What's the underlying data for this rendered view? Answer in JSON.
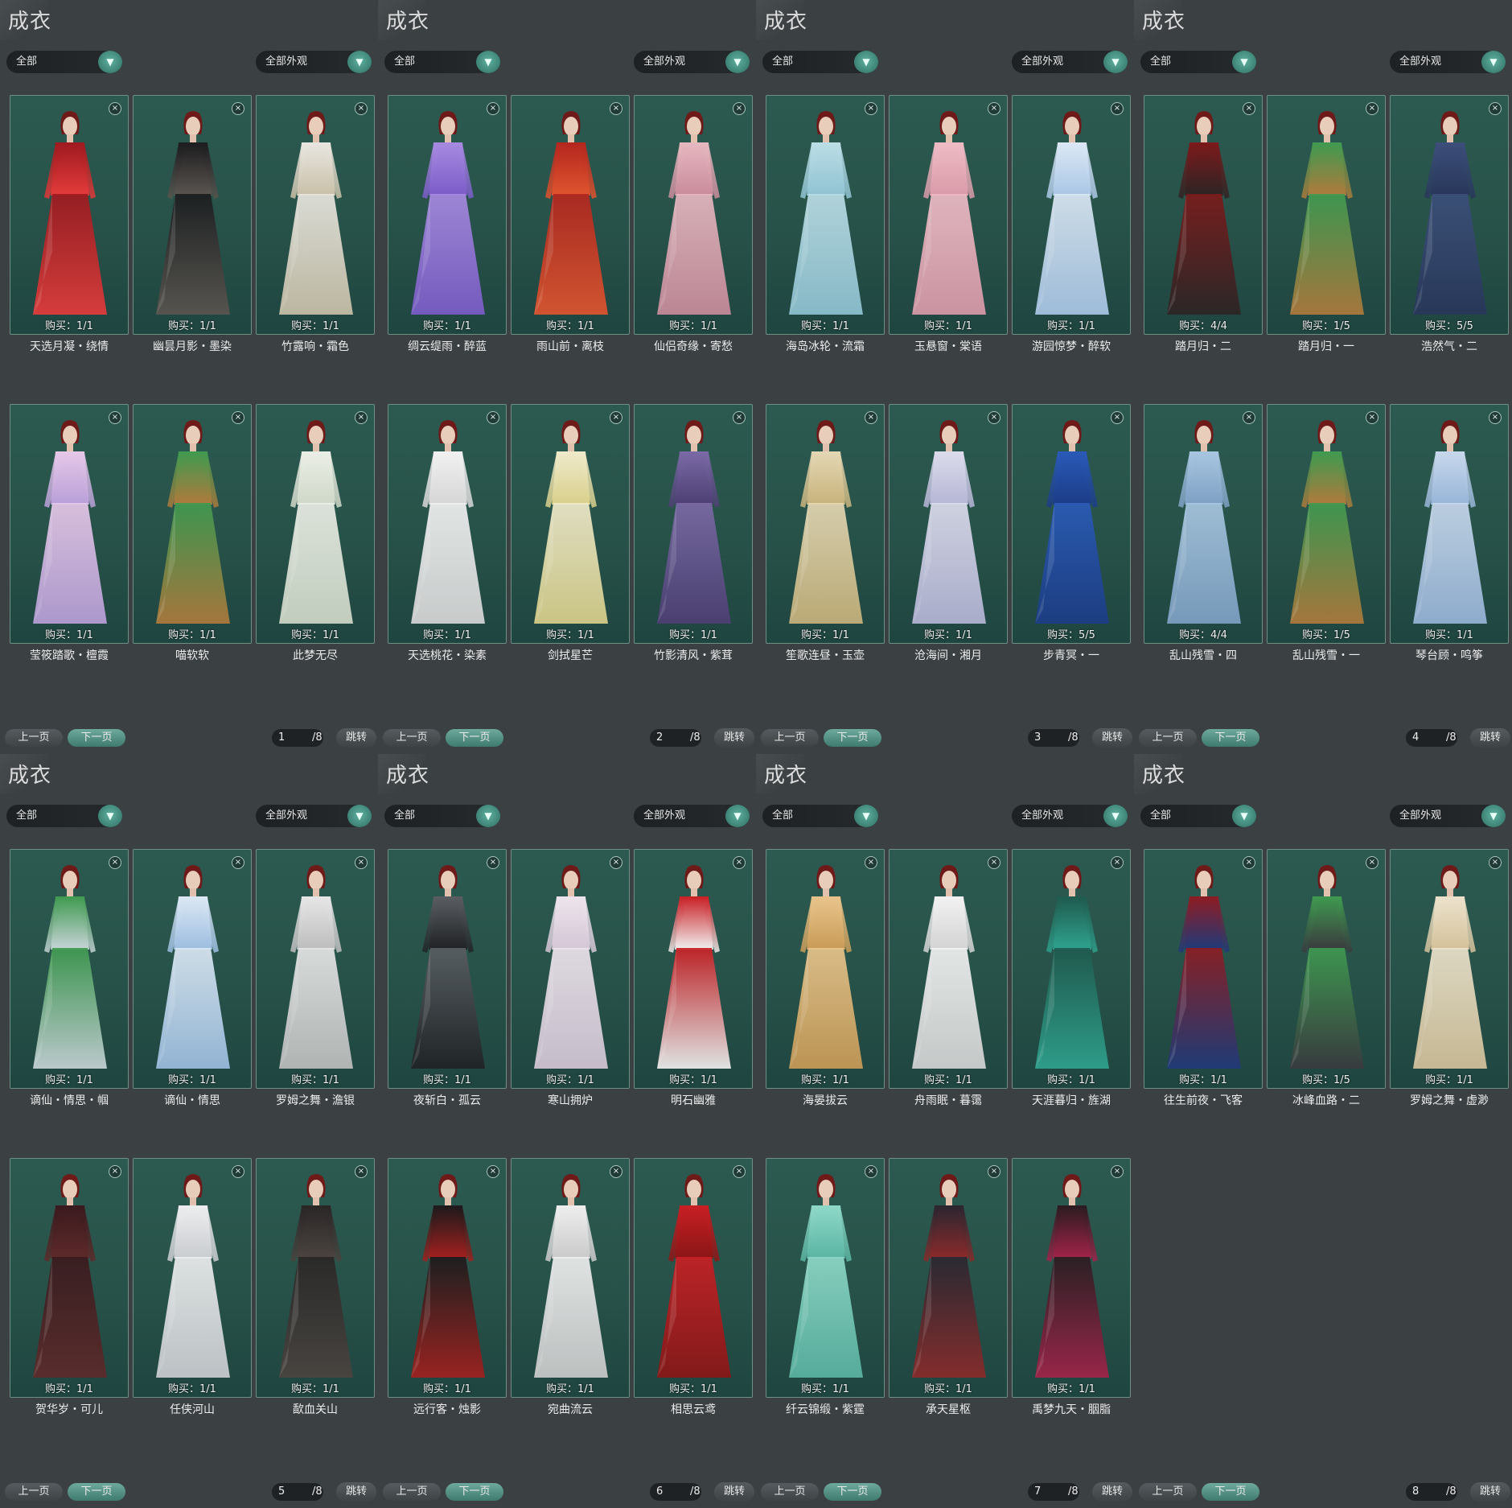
{
  "panels": [
    {
      "title": "成衣",
      "filter_left": "全部",
      "filter_right": "全部外观",
      "prev_label": "上一页",
      "next_label": "下一页",
      "page": "1",
      "total": "/8",
      "jump_label": "跳转",
      "cards": [
        {
          "buy": "购买：1/1",
          "name": "天选月凝・绕情",
          "colors": [
            "#9e1a1f",
            "#e43b3b"
          ]
        },
        {
          "buy": "购买：1/1",
          "name": "幽昙月影・墨染",
          "colors": [
            "#1c1c1e",
            "#5b5550"
          ]
        },
        {
          "buy": "购买：1/1",
          "name": "竹露响・霜色",
          "colors": [
            "#e8e6e0",
            "#c9c0a8"
          ]
        },
        {
          "buy": "购买：1/1",
          "name": "莹筱踏歌・檀霞",
          "colors": [
            "#e6c8e8",
            "#b89fd8"
          ]
        },
        {
          "buy": "购买：1/1",
          "name": "喵软软",
          "colors": [
            "#3f9a50",
            "#b07a3c"
          ]
        },
        {
          "buy": "购买：1/1",
          "name": "此梦无尽",
          "colors": [
            "#ebeee6",
            "#cfd8c8"
          ]
        }
      ]
    },
    {
      "title": "成衣",
      "filter_left": "全部",
      "filter_right": "全部外观",
      "prev_label": "上一页",
      "next_label": "下一页",
      "page": "2",
      "total": "/8",
      "jump_label": "跳转",
      "cards": [
        {
          "buy": "购买：1/1",
          "name": "绸云缇雨・醉蓝",
          "colors": [
            "#a78ae0",
            "#7b5cc9"
          ]
        },
        {
          "buy": "购买：1/1",
          "name": "雨山前・离枝",
          "colors": [
            "#b3261e",
            "#e0552f"
          ]
        },
        {
          "buy": "购买：1/1",
          "name": "仙侣奇缘・寄愁",
          "colors": [
            "#e6b8c0",
            "#c98b9b"
          ]
        },
        {
          "buy": "购买：1/1",
          "name": "天选桃花・染素",
          "colors": [
            "#f1f1f1",
            "#d6d6d6"
          ]
        },
        {
          "buy": "购买：1/1",
          "name": "剑拭星芒",
          "colors": [
            "#efeacb",
            "#d9cf8a"
          ]
        },
        {
          "buy": "购买：1/1",
          "name": "竹影清风・紫茸",
          "colors": [
            "#7b6aa6",
            "#4d3e73"
          ]
        }
      ]
    },
    {
      "title": "成衣",
      "filter_left": "全部",
      "filter_right": "全部外观",
      "prev_label": "上一页",
      "next_label": "下一页",
      "page": "3",
      "total": "/8",
      "jump_label": "跳转",
      "cards": [
        {
          "buy": "购买：1/1",
          "name": "海岛冰轮・流霜",
          "colors": [
            "#bcdde6",
            "#8fc3d2"
          ]
        },
        {
          "buy": "购买：1/1",
          "name": "玉悬窗・棠语",
          "colors": [
            "#efbcc6",
            "#d99aa8"
          ]
        },
        {
          "buy": "购买：1/1",
          "name": "游园惊梦・醉软",
          "colors": [
            "#dce8f4",
            "#a9c6e6"
          ]
        },
        {
          "buy": "购买：1/1",
          "name": "笙歌连昼・玉壶",
          "colors": [
            "#e4d7b4",
            "#c7b27a"
          ]
        },
        {
          "buy": "购买：1/1",
          "name": "沧海间・湘月",
          "colors": [
            "#dcdcec",
            "#b5b5d6"
          ]
        },
        {
          "buy": "购买：5/5",
          "name": "步青冥・一",
          "colors": [
            "#2a5ab8",
            "#1c3c86"
          ]
        }
      ]
    },
    {
      "title": "成衣",
      "filter_left": "全部",
      "filter_right": "全部外观",
      "prev_label": "上一页",
      "next_label": "下一页",
      "page": "4",
      "total": "/8",
      "jump_label": "跳转",
      "cards": [
        {
          "buy": "购买：4/4",
          "name": "踏月归・二",
          "colors": [
            "#7c1a1a",
            "#2c2425"
          ]
        },
        {
          "buy": "购买：1/5",
          "name": "踏月归・一",
          "colors": [
            "#3f9a50",
            "#b07a3c"
          ]
        },
        {
          "buy": "购买：5/5",
          "name": "浩然气・二",
          "colors": [
            "#3c4f7a",
            "#28365a"
          ]
        },
        {
          "buy": "购买：4/4",
          "name": "乱山残雪・四",
          "colors": [
            "#a8c6e0",
            "#7ea0c4"
          ]
        },
        {
          "buy": "购买：1/5",
          "name": "乱山残雪・一",
          "colors": [
            "#3f9a50",
            "#b07a3c"
          ]
        },
        {
          "buy": "购买：1/1",
          "name": "琴台顾・鸣筝",
          "colors": [
            "#c8d8ec",
            "#97b4d8"
          ]
        }
      ]
    },
    {
      "title": "成衣",
      "filter_left": "全部",
      "filter_right": "全部外观",
      "prev_label": "上一页",
      "next_label": "下一页",
      "page": "5",
      "total": "/8",
      "jump_label": "跳转",
      "cards": [
        {
          "buy": "购买：1/1",
          "name": "谪仙・情思・帼",
          "colors": [
            "#3f9a50",
            "#c8d4d8"
          ]
        },
        {
          "buy": "购买：1/1",
          "name": "谪仙・情思",
          "colors": [
            "#dce8f4",
            "#9cbde0"
          ]
        },
        {
          "buy": "购买：1/1",
          "name": "罗姆之舞・澹银",
          "colors": [
            "#e6e6e6",
            "#bdbdbd"
          ]
        },
        {
          "buy": "购买：1/1",
          "name": "贺华岁・可儿",
          "colors": [
            "#3a1a1e",
            "#5e2a2a"
          ]
        },
        {
          "buy": "购买：1/1",
          "name": "任侠河山",
          "colors": [
            "#ecedee",
            "#c9ccd0"
          ]
        },
        {
          "buy": "购买：1/1",
          "name": "歃血关山",
          "colors": [
            "#2a2626",
            "#4b4440"
          ]
        }
      ]
    },
    {
      "title": "成衣",
      "filter_left": "全部",
      "filter_right": "全部外观",
      "prev_label": "上一页",
      "next_label": "下一页",
      "page": "6",
      "total": "/8",
      "jump_label": "跳转",
      "cards": [
        {
          "buy": "购买：1/1",
          "name": "夜斩白・孤云",
          "colors": [
            "#5a5e62",
            "#1f2124"
          ]
        },
        {
          "buy": "购买：1/1",
          "name": "寒山拥炉",
          "colors": [
            "#ede4ec",
            "#d4c6d6"
          ]
        },
        {
          "buy": "购买：1/1",
          "name": "明石幽雅",
          "colors": [
            "#c81f24",
            "#f0f0f0"
          ]
        },
        {
          "buy": "购买：1/1",
          "name": "远行客・烛影",
          "colors": [
            "#1c1a1c",
            "#a3201e"
          ]
        },
        {
          "buy": "购买：1/1",
          "name": "宛曲流云",
          "colors": [
            "#eeeeee",
            "#cacaca"
          ]
        },
        {
          "buy": "购买：1/1",
          "name": "相思云鸢",
          "colors": [
            "#c81f24",
            "#8a1616"
          ]
        }
      ]
    },
    {
      "title": "成衣",
      "filter_left": "全部",
      "filter_right": "全部外观",
      "prev_label": "上一页",
      "next_label": "下一页",
      "page": "7",
      "total": "/8",
      "jump_label": "跳转",
      "cards": [
        {
          "buy": "购买：1/1",
          "name": "海晏拔云",
          "colors": [
            "#e8c48c",
            "#c99b56"
          ]
        },
        {
          "buy": "购买：1/1",
          "name": "舟雨眠・暮霭",
          "colors": [
            "#f2f2f2",
            "#d3d3d3"
          ]
        },
        {
          "buy": "购买：1/1",
          "name": "天涯暮归・旌湖",
          "colors": [
            "#1f5a4e",
            "#2fa38f"
          ]
        },
        {
          "buy": "购买：1/1",
          "name": "纤云锦缎・紫霆",
          "colors": [
            "#8fd8c8",
            "#5ab4a2"
          ]
        },
        {
          "buy": "购买：1/1",
          "name": "承天星枢",
          "colors": [
            "#2a2630",
            "#8c2a2a"
          ]
        },
        {
          "buy": "购买：1/1",
          "name": "禹梦九天・胭脂",
          "colors": [
            "#2a1c20",
            "#a3234a"
          ]
        }
      ]
    },
    {
      "title": "成衣",
      "filter_left": "全部",
      "filter_right": "全部外观",
      "prev_label": "上一页",
      "next_label": "下一页",
      "page": "8",
      "total": "/8",
      "jump_label": "跳转",
      "cards": [
        {
          "buy": "购买：1/1",
          "name": "往生前夜・飞客",
          "colors": [
            "#8e1c22",
            "#1f3a7a"
          ]
        },
        {
          "buy": "购买：1/5",
          "name": "冰峰血路・二",
          "colors": [
            "#3f9a50",
            "#3a3a3e"
          ]
        },
        {
          "buy": "购买：1/1",
          "name": "罗姆之舞・虚渺",
          "colors": [
            "#ece2cc",
            "#d4c19a"
          ]
        }
      ]
    }
  ],
  "icons": {
    "dropdown": "chevron-down-icon",
    "delete": "trash-icon"
  }
}
